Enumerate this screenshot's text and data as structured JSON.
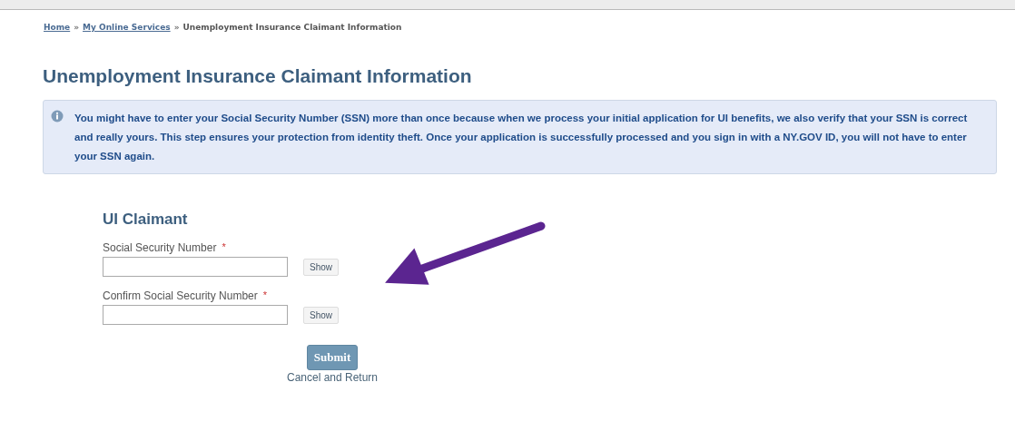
{
  "breadcrumb": [
    {
      "label": "Home",
      "kind": "link"
    },
    {
      "label": "»",
      "kind": "separator"
    },
    {
      "label": "My Online Services",
      "kind": "link"
    },
    {
      "label": "»",
      "kind": "separator"
    },
    {
      "label": "Unemployment Insurance Claimant Information",
      "kind": "current"
    }
  ],
  "title": "Unemployment Insurance Claimant Information",
  "notice": "You might have to enter your Social Security Number (SSN) more than once because when we process your initial application for UI benefits, we also verify that your SSN is correct and really yours. This step ensures your protection from identity theft. Once your application is successfully processed and you sign in with a NY.GOV ID, you will not have to enter your SSN again.",
  "form": {
    "heading": "UI Claimant",
    "fields": [
      {
        "label": "Social Security Number",
        "required_mark": "*",
        "button": "Show"
      },
      {
        "label": "Confirm Social Security Number",
        "required_mark": "*",
        "button": "Show"
      }
    ]
  },
  "submit": "Submit",
  "cancel": "Cancel and Return"
}
